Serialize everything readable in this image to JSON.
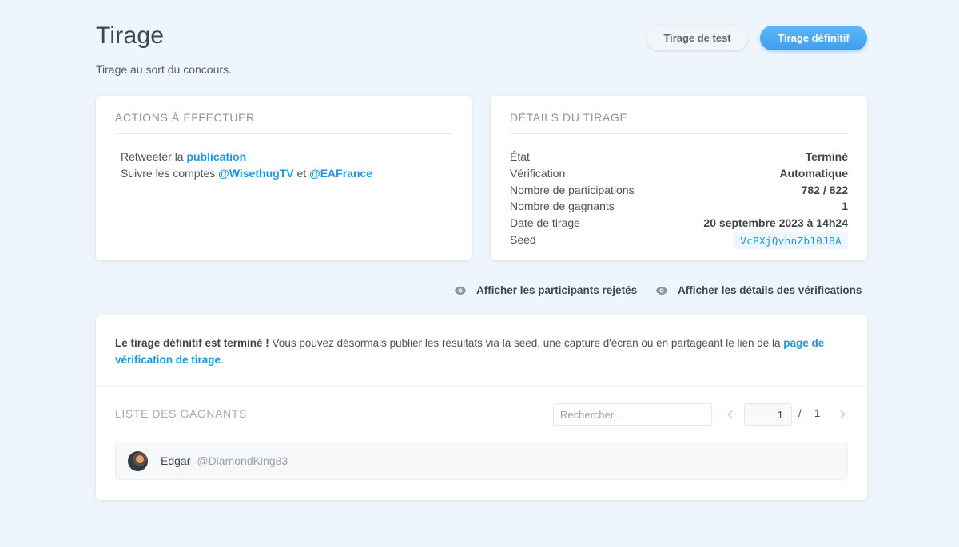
{
  "header": {
    "title": "Tirage",
    "subtitle": "Tirage au sort du concours.",
    "test_button": "Tirage de test",
    "final_button": "Tirage définitif"
  },
  "actions": {
    "title": "Actions à effectuer",
    "line1_prefix": "Retweeter la ",
    "line1_link": "publication",
    "line2_prefix": "Suivre les comptes ",
    "line2_link1": "@WisethugTV",
    "line2_mid": " et ",
    "line2_link2": "@EAFrance"
  },
  "details": {
    "title": "Détails du tirage",
    "rows": [
      {
        "label": "État",
        "value": "Terminé"
      },
      {
        "label": "Vérification",
        "value": "Automatique"
      },
      {
        "label": "Nombre de participations",
        "value": "782 / 822"
      },
      {
        "label": "Nombre de gagnants",
        "value": "1"
      },
      {
        "label": "Date de tirage",
        "value": "20 septembre 2023 à 14h24"
      },
      {
        "label": "Seed",
        "value": "VcPXjQvhnZb10JBA"
      }
    ]
  },
  "toggles": {
    "rejected": "Afficher les participants rejetés",
    "verifications": "Afficher les détails des vérifications"
  },
  "results": {
    "notice_bold": "Le tirage définitif est terminé !",
    "notice_text": " Vous pouvez désormais publier les résultats via la seed, une capture d'écran ou en partageant le lien de la ",
    "notice_link": "page de vérification de tirage",
    "notice_end": ".",
    "winners_title": "Liste des gagnants",
    "search_placeholder": "Rechercher...",
    "pagination": {
      "current": "1",
      "separator": "/",
      "total": "1"
    },
    "winners": [
      {
        "name": "Edgar",
        "handle": "@DiamondKing83"
      }
    ]
  },
  "colors": {
    "background": "#eef5fd",
    "accent": "#1c97e0",
    "primary_button": "#4aa8f2"
  }
}
